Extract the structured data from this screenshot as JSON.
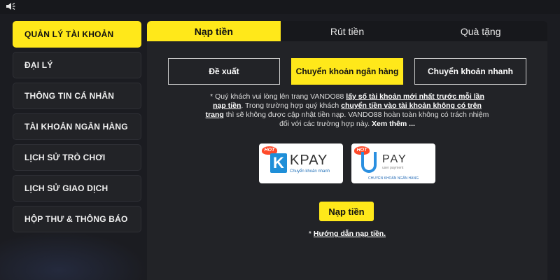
{
  "sidebar": {
    "items": [
      {
        "label": "QUẢN LÝ TÀI KHOẢN"
      },
      {
        "label": "ĐẠI LÝ"
      },
      {
        "label": "THÔNG TIN CÁ NHÂN"
      },
      {
        "label": "TÀI KHOẢN NGÂN HÀNG"
      },
      {
        "label": "LỊCH SỬ TRÒ CHƠI"
      },
      {
        "label": "LỊCH SỬ GIAO DỊCH"
      },
      {
        "label": "HỘP THƯ & THÔNG BÁO"
      }
    ]
  },
  "tabs": [
    {
      "label": "Nạp tiền"
    },
    {
      "label": "Rút tiền"
    },
    {
      "label": "Quà tặng"
    }
  ],
  "methods": [
    {
      "label": "Đề xuất"
    },
    {
      "label": "Chuyển khoản ngân hàng"
    },
    {
      "label": "Chuyển khoản nhanh"
    }
  ],
  "notice": {
    "p1": "* Quý khách vui lòng lên trang VANDO88 ",
    "h1": "lấy số tài khoản mới nhất trước mỗi lần nạp tiền",
    "p2": ". Trong trường hợp quý khách ",
    "h2": "chuyển tiền vào tài khoản không có trên trang",
    "p3": " thì sẽ không được cập nhật tiền nạp. VANDO88 hoàn toàn không có trách nhiệm đối với các trường hợp này. ",
    "more": "Xem thêm ..."
  },
  "providers": {
    "kpay": {
      "badge": "HOT",
      "mark": "K",
      "name": "KPAY",
      "sub": "Chuyển khoản nhanh",
      "icon": "kpay-logo-icon"
    },
    "upay": {
      "badge": "HOT",
      "name": "PAY",
      "sub": "user payment",
      "foot": "CHUYỂN KHOẢN NGÂN HÀNG",
      "icon": "upay-logo-icon"
    }
  },
  "submit_label": "Nạp tiền",
  "guide": {
    "prefix": "* ",
    "link": "Hướng dẫn nạp tiền."
  },
  "colors": {
    "accent": "#ffe81a",
    "background": "#1b1c21",
    "panel": "#222327"
  }
}
